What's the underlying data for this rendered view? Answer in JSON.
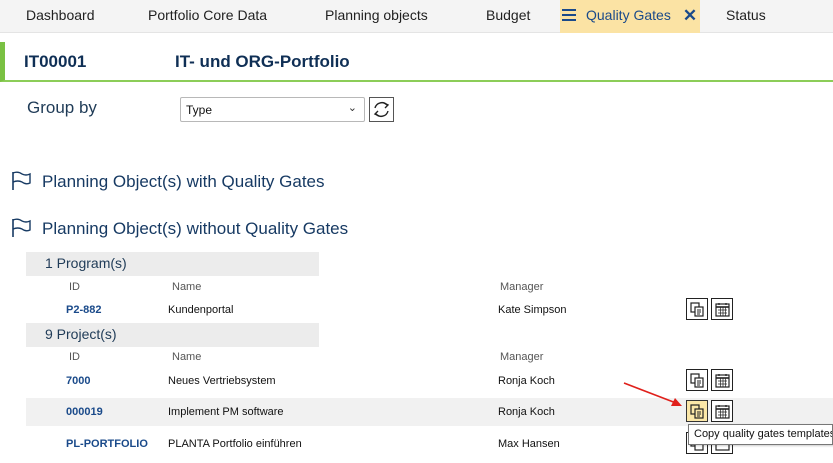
{
  "tabs": [
    {
      "label": "Dashboard",
      "active": false
    },
    {
      "label": "Portfolio Core Data",
      "active": false
    },
    {
      "label": "Planning objects",
      "active": false
    },
    {
      "label": "Budget",
      "active": false
    },
    {
      "label": "Quality Gates",
      "active": true
    },
    {
      "label": "Status",
      "active": false
    }
  ],
  "header": {
    "id": "IT00001",
    "name": "IT- und ORG-Portfolio",
    "accent": "#7ac143"
  },
  "groupby": {
    "label": "Group by",
    "value": "Type"
  },
  "sections": {
    "with_gates": "Planning Object(s) with Quality Gates",
    "without_gates": "Planning Object(s) without Quality Gates"
  },
  "columns": {
    "id": "ID",
    "name": "Name",
    "manager": "Manager"
  },
  "programs": {
    "title": "1 Program(s)",
    "rows": [
      {
        "id": "P2-882",
        "name": "Kundenportal",
        "manager": "Kate Simpson"
      }
    ]
  },
  "projects": {
    "title": "9 Project(s)",
    "rows": [
      {
        "id": "7000",
        "name": "Neues Vertriebsystem",
        "manager": "Ronja Koch"
      },
      {
        "id": "000019",
        "name": "Implement PM software",
        "manager": "Ronja Koch"
      },
      {
        "id": "PL-PORTFOLIO",
        "name": "PLANTA Portfolio einführen",
        "manager": "Max Hansen"
      }
    ]
  },
  "tooltip": "Copy quality gates templates",
  "icons": {
    "menu": "hamburger-menu-icon",
    "close": "close-icon",
    "refresh": "refresh-icon",
    "flag": "flag-icon",
    "copy": "copy-templates-icon",
    "calendar": "calendar-icon"
  }
}
